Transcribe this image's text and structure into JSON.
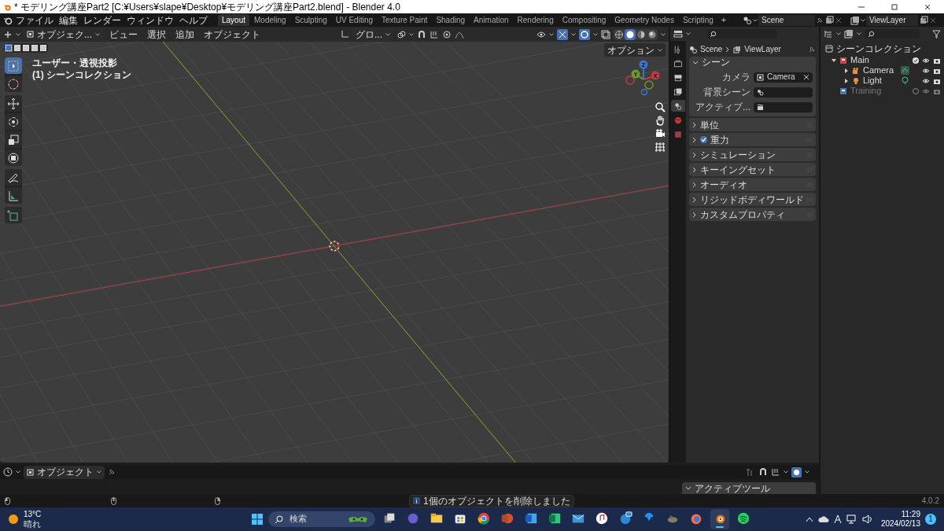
{
  "window": {
    "title": "* モデリング講座Part2 [C:¥Users¥slape¥Desktop¥モデリング講座Part2.blend] - Blender 4.0"
  },
  "menu": [
    "ファイル",
    "編集",
    "レンダー",
    "ウィンドウ",
    "ヘルプ"
  ],
  "workspaces": [
    {
      "label": "Layout",
      "selected": true
    },
    {
      "label": "Modeling",
      "selected": false
    },
    {
      "label": "Sculpting",
      "selected": false
    },
    {
      "label": "UV Editing",
      "selected": false
    },
    {
      "label": "Texture Paint",
      "selected": false
    },
    {
      "label": "Shading",
      "selected": false
    },
    {
      "label": "Animation",
      "selected": false
    },
    {
      "label": "Rendering",
      "selected": false
    },
    {
      "label": "Compositing",
      "selected": false
    },
    {
      "label": "Geometry Nodes",
      "selected": false
    },
    {
      "label": "Scripting",
      "selected": false
    }
  ],
  "add_workspace": "+",
  "scene": "Scene",
  "view_layer": "ViewLayer",
  "viewport": {
    "mode": "オブジェク...",
    "menus": [
      "ビュー",
      "選択",
      "追加",
      "オブジェクト"
    ],
    "orientation": "グロ...",
    "options": "オプション",
    "overlay_lines": [
      "ユーザー・透視投影",
      "(1) シーンコレクション"
    ],
    "gizmo_axes": [
      "Z",
      "Y",
      "X"
    ],
    "shading": [
      {
        "kind": "wireframe",
        "selected": false
      },
      {
        "kind": "solid",
        "selected": true
      },
      {
        "kind": "material",
        "selected": false
      },
      {
        "kind": "rendered",
        "selected": false
      }
    ],
    "tools": [
      {
        "kind": "select",
        "selected": true
      },
      {
        "kind": "cursor",
        "selected": false
      },
      {
        "kind": "move",
        "selected": false
      },
      {
        "kind": "rotate",
        "selected": false
      },
      {
        "kind": "scale",
        "selected": false
      },
      {
        "kind": "transform",
        "selected": false
      },
      {
        "kind": "annotate",
        "selected": false
      },
      {
        "kind": "measure",
        "selected": false
      },
      {
        "kind": "add-cube",
        "selected": false
      }
    ]
  },
  "properties": {
    "breadcrumb": [
      "Scene",
      "ViewLayer"
    ],
    "tabs": [
      {
        "kind": "tool",
        "selected": false
      },
      {
        "kind": "render",
        "selected": false
      },
      {
        "kind": "output",
        "selected": false
      },
      {
        "kind": "view-layer",
        "selected": false
      },
      {
        "kind": "scene",
        "selected": true
      },
      {
        "kind": "world",
        "selected": false
      },
      {
        "kind": "texture",
        "selected": false
      }
    ],
    "scene_panel": {
      "title": "シーン",
      "fields": [
        {
          "label": "カメラ",
          "value": "Camera",
          "kind": "camera"
        },
        {
          "label": "背景シーン",
          "kind": "scene"
        },
        {
          "label": "アクティブ...",
          "kind": "clip"
        }
      ]
    },
    "panels": [
      {
        "label": "単位",
        "kind": "plain"
      },
      {
        "label": "重力",
        "kind": "checkbox",
        "checked": true
      },
      {
        "label": "シミュレーション",
        "kind": "plain"
      },
      {
        "label": "キーイングセット",
        "kind": "plain"
      },
      {
        "label": "オーディオ",
        "kind": "plain"
      },
      {
        "label": "リジッドボディワールド",
        "kind": "plain"
      },
      {
        "label": "カスタムプロパティ",
        "kind": "plain"
      }
    ]
  },
  "outliner": {
    "root": "シーンコレクション",
    "collections": [
      {
        "name": "Main",
        "enabled": true,
        "children": [
          {
            "name": "Camera",
            "kind": "camera"
          },
          {
            "name": "Light",
            "kind": "light"
          }
        ]
      },
      {
        "name": "Training",
        "enabled": false
      }
    ]
  },
  "timeline": {
    "mode": "オブジェクト",
    "active_tool": "アクティブツール"
  },
  "status": {
    "message": "1個のオブジェクトを削除しました",
    "version": "4.0.2"
  },
  "taskbar": {
    "temperature": "13°C",
    "weather": "晴れ",
    "search": "検索",
    "apps": [
      {
        "kind": "taskview",
        "active": false
      },
      {
        "kind": "meet",
        "active": false
      },
      {
        "kind": "explorer",
        "active": false
      },
      {
        "kind": "store",
        "active": false
      },
      {
        "kind": "chrome",
        "active": false
      },
      {
        "kind": "powerpoint",
        "active": false
      },
      {
        "kind": "word",
        "active": false
      },
      {
        "kind": "excel",
        "active": false
      },
      {
        "kind": "mail",
        "active": false
      },
      {
        "kind": "music",
        "active": false
      },
      {
        "kind": "help",
        "active": false
      },
      {
        "kind": "download",
        "active": false
      },
      {
        "kind": "gimp",
        "active": false
      },
      {
        "kind": "firefox",
        "active": false
      },
      {
        "kind": "blender",
        "active": true
      },
      {
        "kind": "spotify",
        "active": false
      }
    ],
    "time": "11:29",
    "date": "2024/02/13",
    "notifications": "1"
  }
}
